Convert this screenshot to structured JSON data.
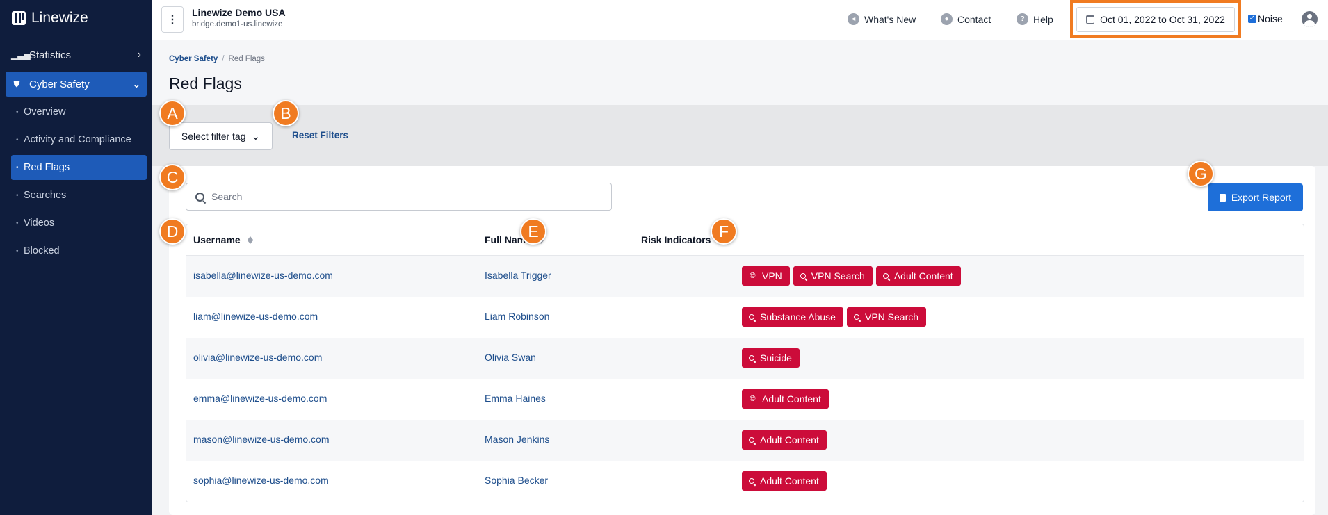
{
  "sidebar": {
    "brand": "Linewize",
    "nav": [
      {
        "label": "Statistics",
        "icon": "bar-chart-icon"
      },
      {
        "label": "Cyber Safety",
        "icon": "shield-icon"
      }
    ],
    "sub_items": [
      {
        "label": "Overview"
      },
      {
        "label": "Activity and Compliance"
      },
      {
        "label": "Red Flags",
        "active": true
      },
      {
        "label": "Searches"
      },
      {
        "label": "Videos"
      },
      {
        "label": "Blocked"
      }
    ]
  },
  "header": {
    "org_name": "Linewize Demo USA",
    "org_host": "bridge.demo1-us.linewize",
    "whats_new": "What's New",
    "contact": "Contact",
    "help": "Help",
    "date_range": "Oct 01, 2022 to Oct 31, 2022",
    "noise_label": "Noise",
    "noise_checked": true
  },
  "breadcrumb": {
    "parent": "Cyber Safety",
    "separator": "/",
    "current": "Red Flags"
  },
  "page_title": "Red Flags",
  "filters": {
    "select_label": "Select filter tag",
    "reset_label": "Reset Filters"
  },
  "search": {
    "placeholder": "Search",
    "value": ""
  },
  "export_label": "Export Report",
  "table": {
    "columns": [
      "Username",
      "Full Name",
      "Risk Indicators"
    ],
    "rows": [
      {
        "username": "isabella@linewize-us-demo.com",
        "full_name": "Isabella Trigger",
        "risks": [
          {
            "label": "VPN",
            "icon": "globe-icon"
          },
          {
            "label": "VPN Search",
            "icon": "search-icon"
          },
          {
            "label": "Adult Content",
            "icon": "search-icon"
          }
        ]
      },
      {
        "username": "liam@linewize-us-demo.com",
        "full_name": "Liam Robinson",
        "risks": [
          {
            "label": "Substance Abuse",
            "icon": "search-icon"
          },
          {
            "label": "VPN Search",
            "icon": "search-icon"
          }
        ]
      },
      {
        "username": "olivia@linewize-us-demo.com",
        "full_name": "Olivia Swan",
        "risks": [
          {
            "label": "Suicide",
            "icon": "search-icon"
          }
        ]
      },
      {
        "username": "emma@linewize-us-demo.com",
        "full_name": "Emma Haines",
        "risks": [
          {
            "label": "Adult Content",
            "icon": "globe-icon"
          }
        ]
      },
      {
        "username": "mason@linewize-us-demo.com",
        "full_name": "Mason Jenkins",
        "risks": [
          {
            "label": "Adult Content",
            "icon": "search-icon"
          }
        ]
      },
      {
        "username": "sophia@linewize-us-demo.com",
        "full_name": "Sophia Becker",
        "risks": [
          {
            "label": "Adult Content",
            "icon": "search-icon"
          }
        ]
      }
    ]
  },
  "markers": {
    "a": "A",
    "b": "B",
    "c": "C",
    "d": "D",
    "e": "E",
    "f": "F",
    "g": "G"
  },
  "colors": {
    "sidebar_bg": "#0f1d3d",
    "accent": "#1e6fd9",
    "risk_badge": "#cc0c3a",
    "marker": "#f07b21",
    "highlight": "#f07b21"
  }
}
